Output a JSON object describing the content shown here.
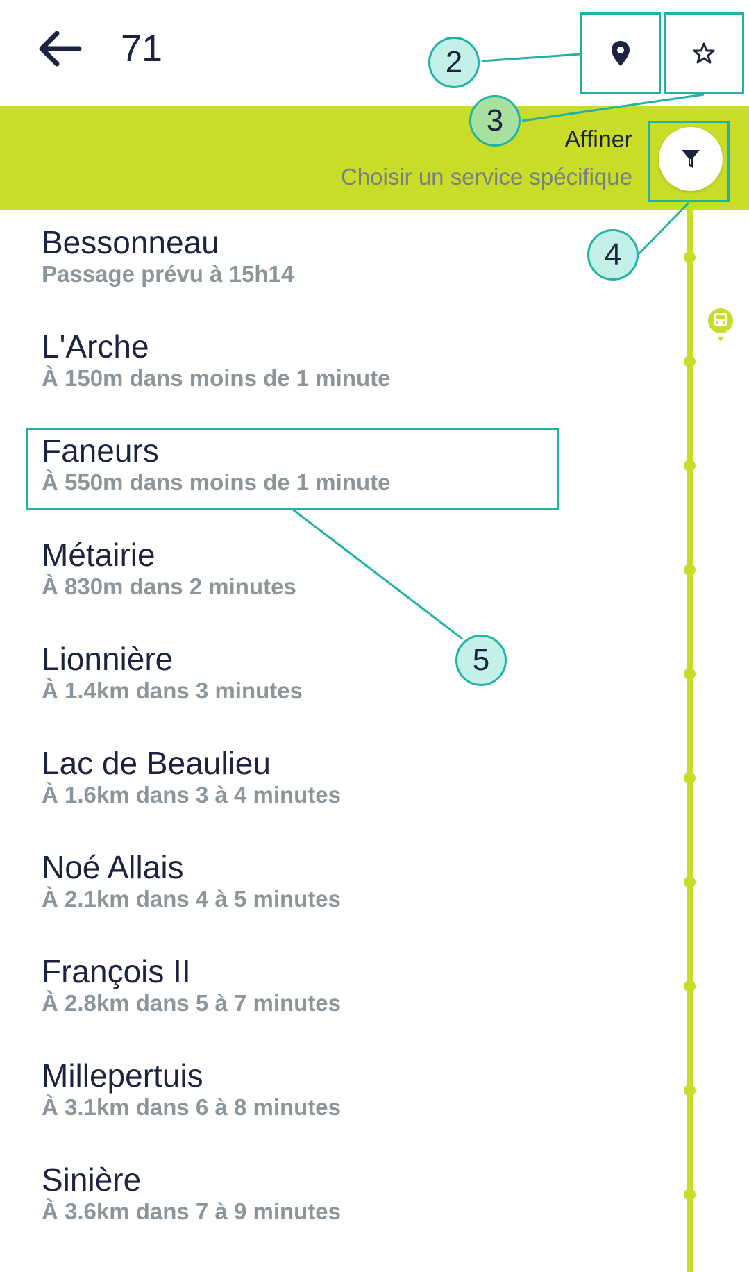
{
  "header": {
    "line_number": "71",
    "back_icon": "arrow-left-icon",
    "locate_icon": "map-pin-icon",
    "favorite_icon": "star-outline-icon"
  },
  "filter": {
    "title": "Affiner",
    "subtitle": "Choisir un service spécifique",
    "icon": "filter-icon"
  },
  "stops": [
    {
      "name": "Bessonneau",
      "info": "Passage prévu à 15h14"
    },
    {
      "name": "L'Arche",
      "info": "À 150m dans moins de 1 minute"
    },
    {
      "name": "Faneurs",
      "info": "À 550m dans moins de 1 minute"
    },
    {
      "name": "Métairie",
      "info": "À 830m dans 2 minutes"
    },
    {
      "name": "Lionnière",
      "info": "À 1.4km dans 3 minutes"
    },
    {
      "name": "Lac de Beaulieu",
      "info": "À 1.6km dans 3 à 4 minutes"
    },
    {
      "name": "Noé Allais",
      "info": "À 2.1km dans 4 à 5 minutes"
    },
    {
      "name": "François II",
      "info": "À 2.8km dans 5 à 7 minutes"
    },
    {
      "name": "Millepertuis",
      "info": "À 3.1km dans 6 à 8 minutes"
    },
    {
      "name": "Sinière",
      "info": "À 3.6km dans 7 à 9 minutes"
    }
  ],
  "callouts": {
    "c2": "2",
    "c3": "3",
    "c4": "4",
    "c5": "5"
  },
  "colors": {
    "accent": "#c8dc28",
    "annotation": "#20b2a2",
    "text_primary": "#1b2340",
    "text_secondary": "#8c959b"
  }
}
